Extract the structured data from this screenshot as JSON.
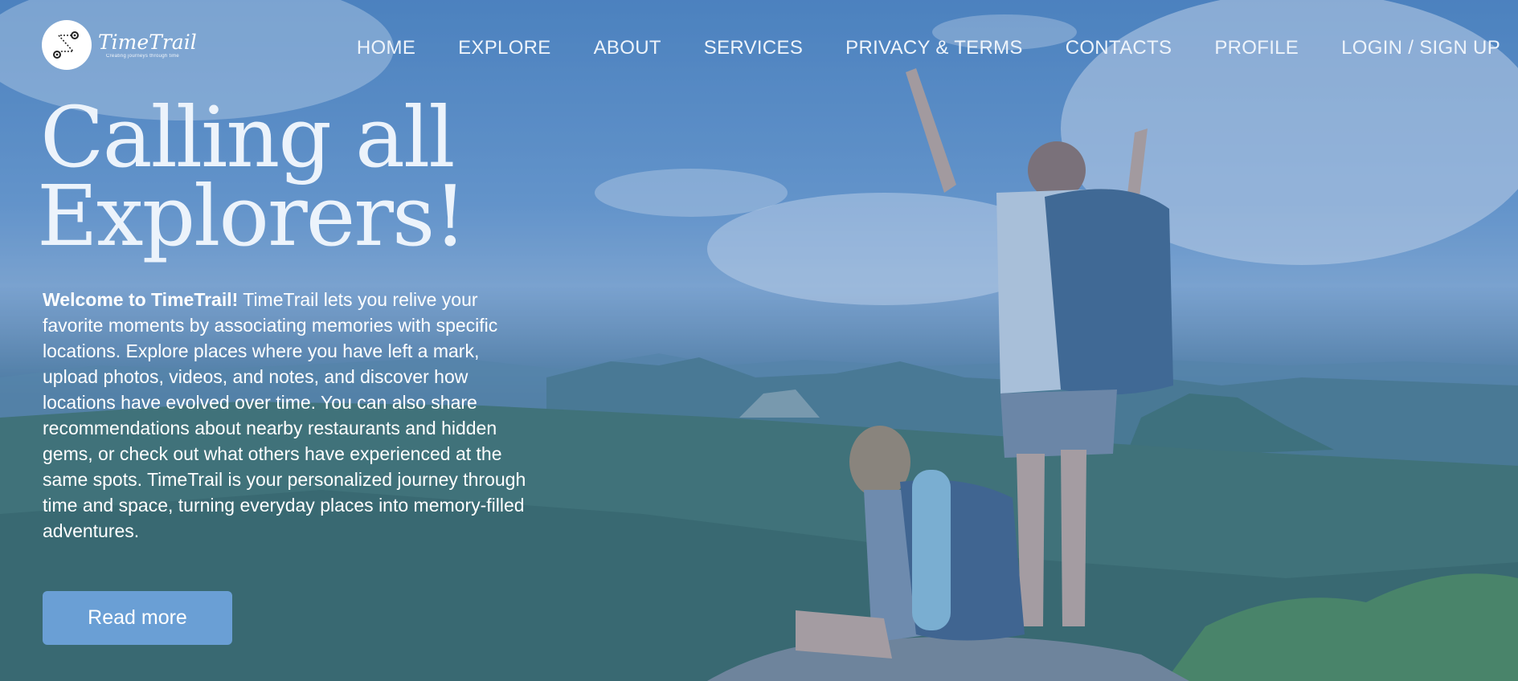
{
  "brand": {
    "name": "TimeTrail",
    "tagline": "Creating journeys through time"
  },
  "nav": {
    "items": [
      "HOME",
      "EXPLORE",
      "ABOUT",
      "SERVICES",
      "PRIVACY & TERMS",
      "CONTACTS",
      "PROFILE",
      "LOGIN / SIGN UP"
    ]
  },
  "hero": {
    "headline_line1": "Calling all",
    "headline_line2": "Explorers!",
    "intro_bold": "Welcome to TimeTrail!",
    "intro_text": " TimeTrail lets you relive your favorite moments by associating memories with specific locations. Explore places where you have left a mark, upload photos, videos, and notes, and discover how locations have evolved over time. You can also share recommendations about nearby restaurants and hidden gems, or check out what others have experienced at the same spots. TimeTrail is your personalized journey through time and space, turning everyday places into memory-filled adventures.",
    "button_label": "Read more"
  },
  "colors": {
    "overlay": "#4678be",
    "button": "#6a9fd5",
    "text": "#ffffff"
  }
}
